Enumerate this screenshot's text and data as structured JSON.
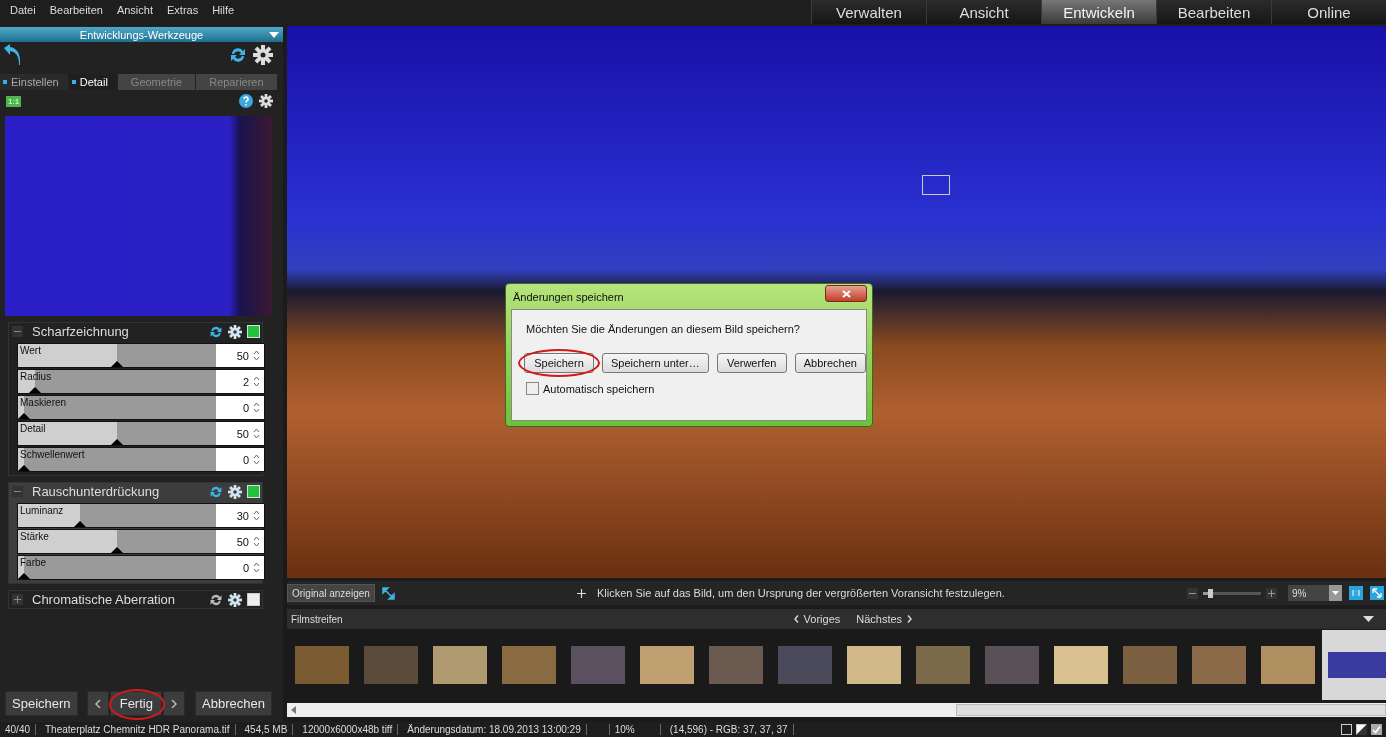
{
  "menu": [
    "Datei",
    "Bearbeiten",
    "Ansicht",
    "Extras",
    "Hilfe"
  ],
  "mode_tabs": [
    {
      "label": "Verwalten",
      "selected": false
    },
    {
      "label": "Ansicht",
      "selected": false
    },
    {
      "label": "Entwickeln",
      "selected": true
    },
    {
      "label": "Bearbeiten",
      "selected": false
    },
    {
      "label": "Online",
      "selected": false
    }
  ],
  "panel": {
    "title": "Entwicklungs-Werkzeuge",
    "tabs": [
      {
        "label": "Einstellen",
        "selected": false,
        "disabled": false
      },
      {
        "label": "Detail",
        "selected": true,
        "disabled": false
      },
      {
        "label": "Geometrie",
        "selected": false,
        "disabled": true
      },
      {
        "label": "Reparieren",
        "selected": false,
        "disabled": true
      }
    ],
    "badge": "1:1",
    "sections": [
      {
        "title": "Scharfzeichnung",
        "expanded": true,
        "enabled": true,
        "highlighted": false,
        "sliders": [
          {
            "label": "Wert",
            "value": "50",
            "level": 0.5
          },
          {
            "label": "Radius",
            "value": "2",
            "level": 0.06
          },
          {
            "label": "Maskieren",
            "value": "0",
            "level": 0
          },
          {
            "label": "Detail",
            "value": "50",
            "level": 0.5
          },
          {
            "label": "Schwellenwert",
            "value": "0",
            "level": 0
          }
        ]
      },
      {
        "title": "Rauschunterdrückung",
        "expanded": true,
        "enabled": true,
        "highlighted": true,
        "sliders": [
          {
            "label": "Luminanz",
            "value": "30",
            "level": 0.3
          },
          {
            "label": "Stärke",
            "value": "50",
            "level": 0.5
          },
          {
            "label": "Farbe",
            "value": "0",
            "level": 0
          }
        ]
      },
      {
        "title": "Chromatische Aberration",
        "expanded": false,
        "enabled": false,
        "highlighted": false
      }
    ],
    "buttons": {
      "save": "Speichern",
      "done": "Fertig",
      "cancel": "Abbrechen"
    }
  },
  "dialog": {
    "title": "Änderungen speichern",
    "message": "Möchten Sie die Änderungen an diesem Bild speichern?",
    "buttons": [
      {
        "label": "Speichern",
        "highlighted": true
      },
      {
        "label": "Speichern unter…",
        "highlighted": false
      },
      {
        "label": "Verwerfen",
        "highlighted": false
      },
      {
        "label": "Abbrechen",
        "highlighted": false
      }
    ],
    "checkbox": {
      "label": "Automatisch speichern",
      "checked": false
    }
  },
  "toolbar": {
    "original_button": "Original anzeigen",
    "hint": "Klicken Sie auf das Bild, um den Ursprung der vergrößerten Voransicht festzulegen.",
    "zoom": {
      "level": 0.1
    },
    "zoom_value": "9%"
  },
  "filmstrip": {
    "title": "Filmstreifen",
    "prev": "Voriges",
    "next": "Nächstes",
    "thumbnails": [
      {
        "selected": false
      },
      {
        "selected": false
      },
      {
        "selected": false
      },
      {
        "selected": false
      },
      {
        "selected": false
      },
      {
        "selected": false
      },
      {
        "selected": false
      },
      {
        "selected": false
      },
      {
        "selected": false
      },
      {
        "selected": false
      },
      {
        "selected": false
      },
      {
        "selected": false
      },
      {
        "selected": false
      },
      {
        "selected": false
      },
      {
        "selected": false
      },
      {
        "selected": true
      }
    ]
  },
  "status_bar": [
    "40/40",
    "Theaterplatz Chemnitz HDR Panorama.tif",
    "454,5 MB",
    "12000x6000x48b tiff",
    "Änderungsdatum: 18.09.2013 13:00:29",
    "10%",
    "(14,596) - RGB: 37, 37, 37"
  ]
}
